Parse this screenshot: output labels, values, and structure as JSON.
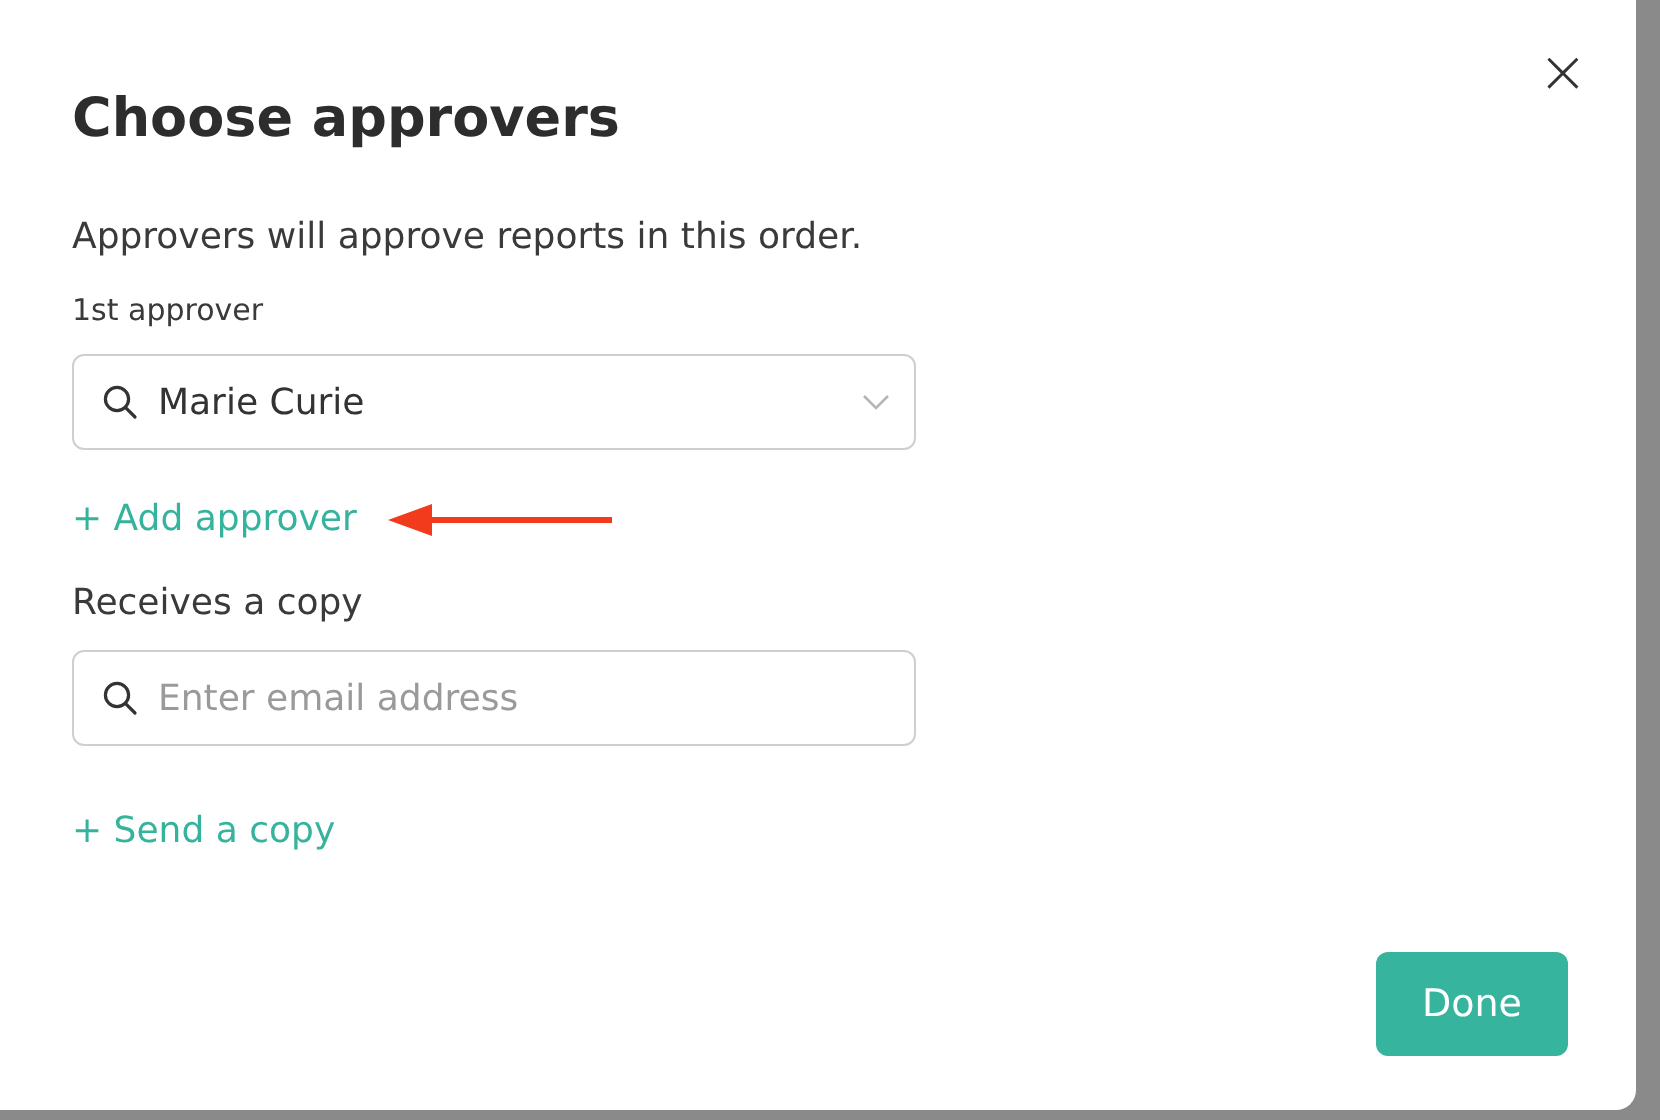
{
  "dialog": {
    "title": "Choose approvers",
    "description": "Approvers will approve reports in this order.",
    "close": "×"
  },
  "approvers": [
    {
      "label": "1st approver",
      "value": "Marie Curie"
    }
  ],
  "add_approver": "+ Add approver",
  "copy": {
    "label": "Receives a copy",
    "placeholder": "Enter email address"
  },
  "send_copy": "+ Send a copy",
  "buttons": [
    "Done"
  ]
}
